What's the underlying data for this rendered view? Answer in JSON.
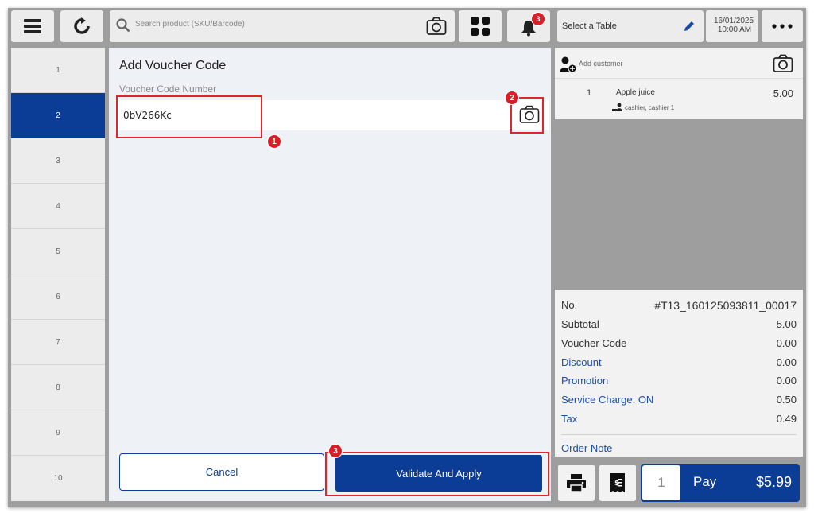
{
  "topbar": {
    "search_placeholder": "Search product (SKU/Barcode)",
    "notification_count": "3",
    "table_label": "Select a Table",
    "date": "16/01/2025",
    "time": "10:00 AM"
  },
  "sidebar": {
    "items": [
      "1",
      "2",
      "3",
      "4",
      "5",
      "6",
      "7",
      "8",
      "9",
      "10"
    ],
    "active": "2"
  },
  "dialog": {
    "title": "Add Voucher Code",
    "field_label": "Voucher Code Number",
    "field_value": "0bV266Kc",
    "cancel_label": "Cancel",
    "validate_label": "Validate And Apply"
  },
  "annotations": {
    "badge1": "1",
    "badge2": "2",
    "badge3": "3"
  },
  "order": {
    "add_customer": "Add customer",
    "items": [
      {
        "qty": "1",
        "name": "Apple juice",
        "price": "5.00",
        "staff": "cashier, cashier 1"
      }
    ]
  },
  "summary": {
    "no_label": "No.",
    "no_value": "#T13_160125093811_00017",
    "subtotal_label": "Subtotal",
    "subtotal_value": "5.00",
    "voucher_label": "Voucher Code",
    "voucher_value": "0.00",
    "discount_label": "Discount",
    "discount_value": "0.00",
    "promotion_label": "Promotion",
    "promotion_value": "0.00",
    "service_label": "Service Charge: ON",
    "service_value": "0.50",
    "tax_label": "Tax",
    "tax_value": "0.49",
    "order_note_label": "Order Note"
  },
  "pay": {
    "qty": "1",
    "label": "Pay",
    "total": "$5.99"
  },
  "colors": {
    "accent": "#0b3c96",
    "link": "#1f4fa3",
    "highlight": "#e0252b",
    "badge": "#d61f26"
  }
}
